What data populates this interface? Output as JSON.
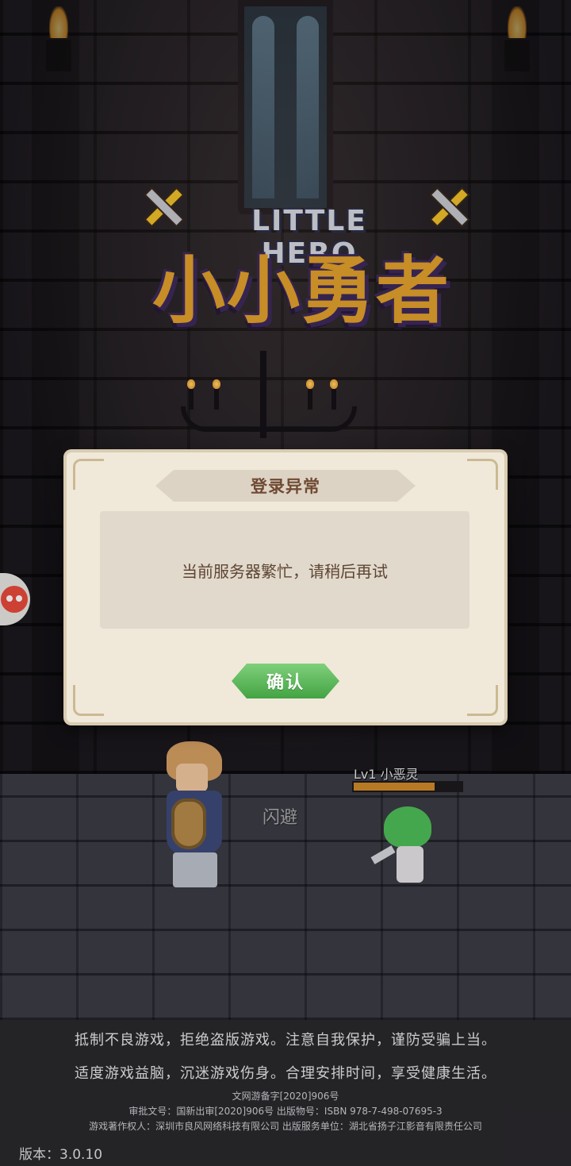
{
  "game": {
    "logo_en": "LITTLE HERO",
    "logo_cn": "小小勇者"
  },
  "dialog": {
    "title": "登录异常",
    "message": "当前服务器繁忙，请稍后再试",
    "confirm_label": "确认"
  },
  "battle": {
    "enemy_name": "Lv1 小恶灵",
    "enemy_hp_fraction": 0.75,
    "float_text": "闪避"
  },
  "footer": {
    "notice_line1": "抵制不良游戏，拒绝盗版游戏。注意自我保护，谨防受骗上当。",
    "notice_line2": "适度游戏益脑，沉迷游戏伤身。合理安排时间，享受健康生活。",
    "reg_line1": "文网游备字[2020]906号",
    "reg_line2": "审批文号：国新出审[2020]906号 出版物号：ISBN 978-7-498-07695-3",
    "reg_line3": "游戏著作权人：深圳市良风网络科技有限公司 出版服务单位：湖北省扬子江影音有限责任公司",
    "version": "版本：3.0.10"
  },
  "icons": {
    "side_icon": "mascot-icon",
    "sword_left": "sword-icon",
    "sword_right": "sword-icon"
  },
  "colors": {
    "dialog_bg": "#f0e9da",
    "title_text": "#6f4a34",
    "confirm_green": "#43a443",
    "logo_gold": "#e3a12c",
    "hp_orange": "#d28a2a"
  }
}
